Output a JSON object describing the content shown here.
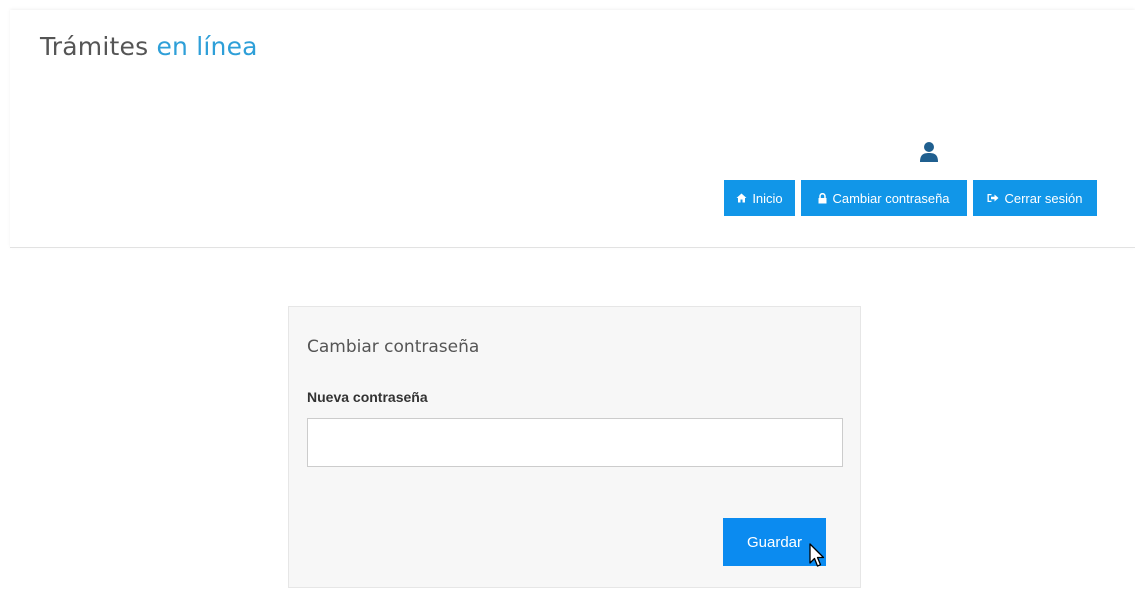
{
  "header": {
    "brand_part1": "Trámites",
    "brand_part2": "en línea"
  },
  "user_icon": "user-icon",
  "nav": {
    "inicio": {
      "label": "Inicio",
      "icon": "home-icon"
    },
    "cambiar": {
      "label": "Cambiar contraseña",
      "icon": "lock-icon"
    },
    "cerrar": {
      "label": "Cerrar sesión",
      "icon": "sign-out-icon"
    }
  },
  "form": {
    "title": "Cambiar contraseña",
    "password_label": "Nueva contraseña",
    "password_value": "",
    "save_label": "Guardar"
  },
  "colors": {
    "brand_accent": "#2e9fd8",
    "nav_button": "#1196e8",
    "save_button": "#0b8bf0",
    "user_icon": "#1f5f8f"
  }
}
